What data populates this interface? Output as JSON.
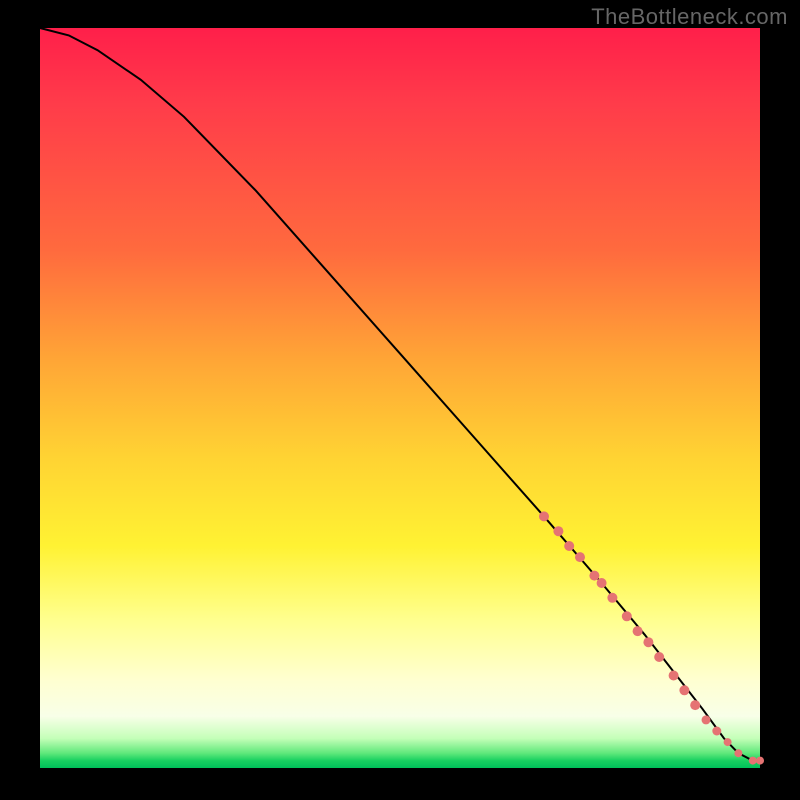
{
  "watermark": "TheBottleneck.com",
  "chart_data": {
    "type": "line",
    "title": "",
    "xlabel": "",
    "ylabel": "",
    "xlim": [
      0,
      100
    ],
    "ylim": [
      0,
      100
    ],
    "curve": {
      "x": [
        0,
        4,
        8,
        14,
        20,
        30,
        40,
        50,
        60,
        70,
        78,
        84,
        88,
        92,
        95,
        97,
        99,
        100
      ],
      "y": [
        100,
        99,
        97,
        93,
        88,
        78,
        67,
        56,
        45,
        34,
        25,
        18,
        13,
        8,
        4,
        2,
        1,
        1
      ]
    },
    "markers": {
      "color": "#e57373",
      "points": [
        {
          "x": 70,
          "y": 34,
          "r": 5
        },
        {
          "x": 72,
          "y": 32,
          "r": 5
        },
        {
          "x": 73.5,
          "y": 30,
          "r": 5
        },
        {
          "x": 75,
          "y": 28.5,
          "r": 5
        },
        {
          "x": 77,
          "y": 26,
          "r": 5
        },
        {
          "x": 78,
          "y": 25,
          "r": 5
        },
        {
          "x": 79.5,
          "y": 23,
          "r": 5
        },
        {
          "x": 81.5,
          "y": 20.5,
          "r": 5
        },
        {
          "x": 83,
          "y": 18.5,
          "r": 5
        },
        {
          "x": 84.5,
          "y": 17,
          "r": 5
        },
        {
          "x": 86,
          "y": 15,
          "r": 5
        },
        {
          "x": 88,
          "y": 12.5,
          "r": 5
        },
        {
          "x": 89.5,
          "y": 10.5,
          "r": 5
        },
        {
          "x": 91,
          "y": 8.5,
          "r": 5
        },
        {
          "x": 92.5,
          "y": 6.5,
          "r": 4.5
        },
        {
          "x": 94,
          "y": 5,
          "r": 4.5
        },
        {
          "x": 95.5,
          "y": 3.5,
          "r": 4
        },
        {
          "x": 97,
          "y": 2,
          "r": 4
        },
        {
          "x": 99,
          "y": 1,
          "r": 4
        },
        {
          "x": 100,
          "y": 1,
          "r": 4
        }
      ]
    }
  }
}
